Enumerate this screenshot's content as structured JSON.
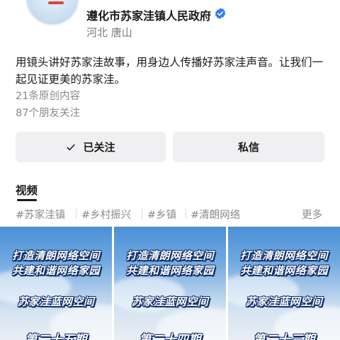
{
  "profile": {
    "name": "遵化市苏家洼镇人民政府",
    "verified_icon": "verified-badge-icon",
    "location": "河北  唐山",
    "bio": "用镜头讲好苏家洼故事，用身边人传播好苏家洼声音。让我们一起见证更美的苏家洼。",
    "works_count": "21条原创内容",
    "friends_following": "87个朋友关注"
  },
  "actions": {
    "follow_label": "已关注",
    "message_label": "私信"
  },
  "tabs": {
    "video": "视频"
  },
  "hashtags": [
    "#苏家洼镇",
    "#乡村振兴",
    "#乡镇",
    "#清朗网络"
  ],
  "more_label": "更多",
  "videos": [
    {
      "line1": "打造清朗网络空间",
      "line2": "共建和谐网络家园",
      "line3": "苏家洼蓝网空间",
      "line4": "第二十五期"
    },
    {
      "line1": "打造清朗网络空间",
      "line2": "共建和谐网络家园",
      "line3": "苏家洼蓝网空间",
      "line4": "第二十四期"
    },
    {
      "line1": "打造清朗网络空间",
      "line2": "共建和谐网络家园",
      "line3": "苏家洼蓝网空间",
      "line4": "第二十三期"
    }
  ],
  "colors": {
    "verified": "#2f7cf6",
    "button_bg": "#f0f0f2",
    "muted_text": "#8a8a8a"
  }
}
